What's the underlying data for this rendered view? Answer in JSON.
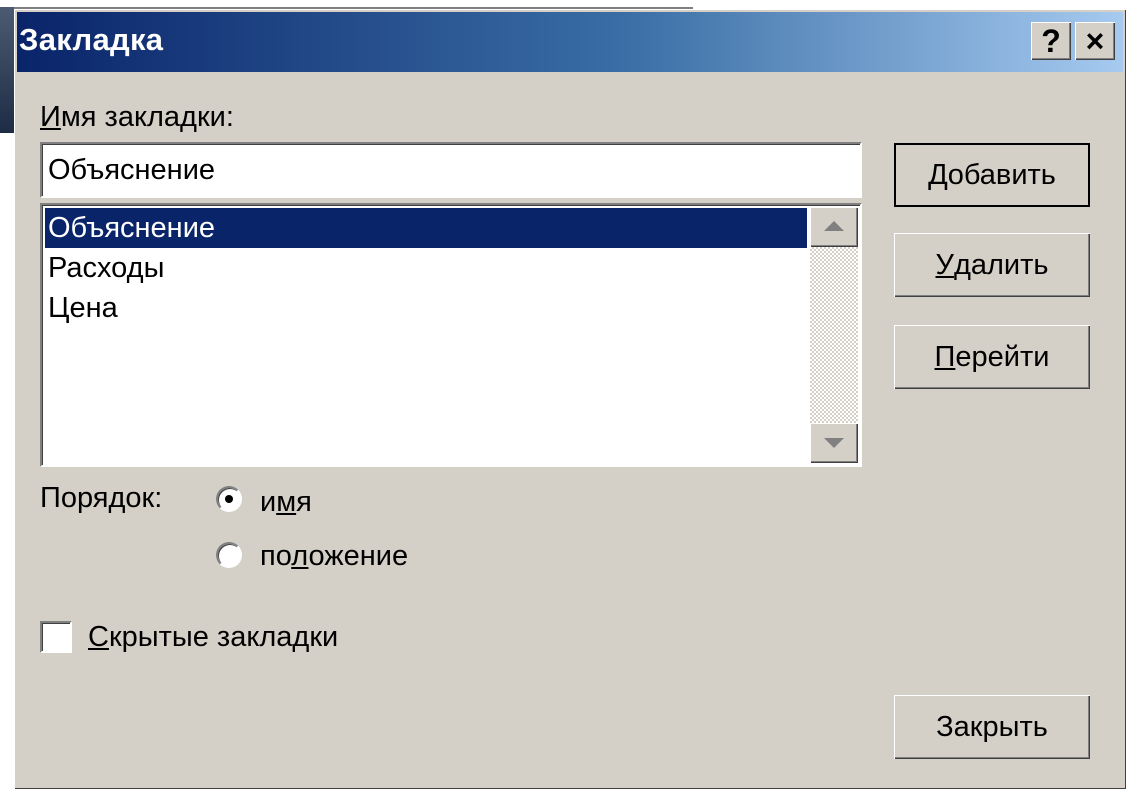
{
  "window": {
    "title": "Закладка",
    "help_button": "?",
    "close_button": "×"
  },
  "name_field": {
    "label_underlined": "И",
    "label_rest": "мя закладки:",
    "value": "Объяснение"
  },
  "bookmark_list": {
    "items": [
      {
        "label": "Объяснение",
        "selected": true
      },
      {
        "label": "Расходы",
        "selected": false
      },
      {
        "label": "Цена",
        "selected": false
      }
    ]
  },
  "buttons": {
    "add": {
      "underlined": "Д",
      "rest": "обавить"
    },
    "delete": {
      "underlined": "У",
      "rest": "далить"
    },
    "goto": {
      "underlined": "П",
      "rest": "ерейти"
    },
    "close": {
      "label": "Закрыть"
    }
  },
  "sort_order": {
    "label": "Порядок:",
    "options": [
      {
        "pre": "и",
        "underlined": "м",
        "post": "я",
        "checked": true
      },
      {
        "pre": "по",
        "underlined": "л",
        "post": "ожение",
        "checked": false
      }
    ]
  },
  "hidden_bookmarks": {
    "underlined": "С",
    "rest": "крытые закладки",
    "checked": false
  }
}
